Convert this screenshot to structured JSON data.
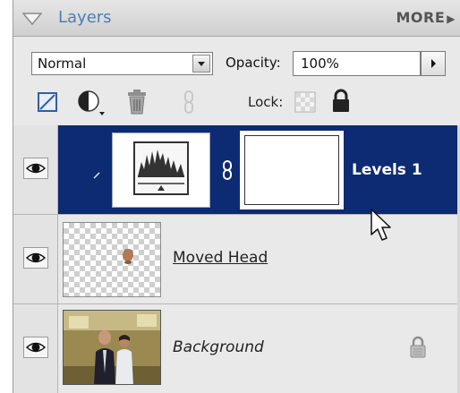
{
  "header": {
    "title": "Layers",
    "more_label": "MORE"
  },
  "blend": {
    "mode": "Normal",
    "opacity_label": "Opacity:",
    "opacity_value": "100%"
  },
  "tools": {
    "lock_label": "Lock:"
  },
  "icons": {
    "collapse": "triangle-down-icon",
    "new_layer": "new-layer-icon",
    "adjustment": "adjustment-layer-icon",
    "delete": "trash-icon",
    "link": "link-icon",
    "lock_transparent": "lock-transparent-icon",
    "lock_all": "padlock-icon",
    "visibility": "eye-icon",
    "cursor": "mouse-pointer-icon"
  },
  "layers": [
    {
      "name": "Levels 1",
      "type": "adjustment",
      "selected": true,
      "visible": true
    },
    {
      "name": "Moved Head",
      "type": "pixel",
      "selected": false,
      "visible": true
    },
    {
      "name": "Background",
      "type": "background",
      "selected": false,
      "visible": true,
      "locked": true
    }
  ],
  "colors": {
    "selected_row": "#0d2b72",
    "title": "#4b7fb8",
    "panel": "#e9e9e9"
  }
}
